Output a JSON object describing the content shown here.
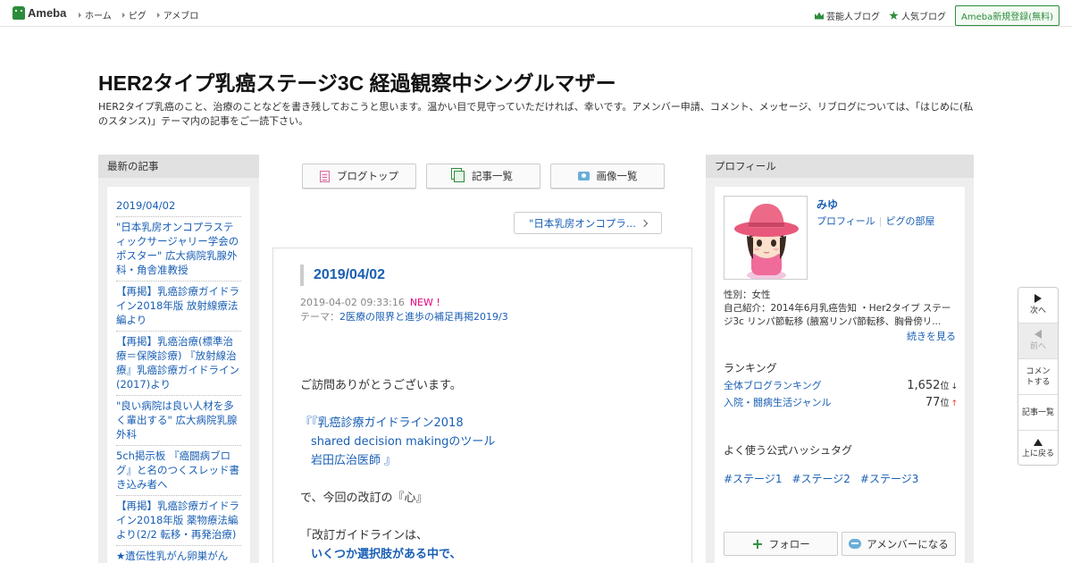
{
  "header": {
    "logo": "Ameba",
    "nav": [
      "ホーム",
      "ピグ",
      "アメブロ"
    ],
    "celebrity_blog": "芸能人ブログ",
    "popular_blog": "人気ブログ",
    "signup": "Ameba新規登録(無料)"
  },
  "blog": {
    "title": "HER2タイプ乳癌ステージ3C 経過観察中シングルマザー",
    "description": "HER2タイプ乳癌のこと、治療のことなどを書き残しておこうと思います。温かい目で見守っていただければ、幸いです。アメンバー申請、コメント、メッセージ、リブログについては、「はじめに(私のスタンス)」テーマ内の記事をご一読下さい。"
  },
  "left": {
    "heading": "最新の記事",
    "items": [
      "2019/04/02",
      "\"日本乳房オンコプラスティックサージャリー学会のポスター\" 広大病院乳腺外科・角舎准教授",
      "【再掲】乳癌診療ガイドライン2018年版 放射線療法編より",
      "【再掲】乳癌治療(標準治療＝保険診療) 『放射線治療』乳癌診療ガイドライン(2017)より",
      "\"良い病院は良い人材を多く輩出する\" 広大病院乳腺外科",
      "5ch掲示板 『癌闘病ブログ』と名のつくスレッド書き込み者へ",
      "【再掲】乳癌診療ガイドライン2018年版 薬物療法編より(2/2 転移・再発治療)",
      "★遺伝性乳がん卵巣がん"
    ]
  },
  "tabs": {
    "blog_top": "ブログトップ",
    "article_list": "記事一覧",
    "image_list": "画像一覧"
  },
  "next_article": "\"日本乳房オンコプラ...",
  "article": {
    "title": "2019/04/02",
    "datetime": "2019-04-02 09:33:16",
    "new_badge": "NEW !",
    "theme_prefix": "テーマ：",
    "theme": "2医療の限界と進歩の補足再掲2019/3",
    "lines": {
      "l1": "ご訪問ありがとうございます。",
      "l2": "『乳癌診療ガイドライン2018",
      "l3": "shared decision makingのツール",
      "l4": "岩田広治医師 』",
      "l5": "で、今回の改訂の『心』",
      "l6": "「改訂ガイドラインは、",
      "l7": "いくつか選択肢がある中で、"
    }
  },
  "profile": {
    "heading": "プロフィール",
    "name": "みゆ",
    "link_profile": "プロフィール",
    "link_pigg": "ピグの部屋",
    "gender": "性別：女性",
    "intro": "自己紹介：2014年6月乳癌告知 ・Her2タイプ ステージ3c リンパ節転移 (腋窩リンパ節転移、胸骨傍リ...",
    "more": "続きを見る",
    "ranking_heading": "ランキング",
    "ranking": [
      {
        "label": "全体ブログランキング",
        "value": "1,652",
        "unit": "位",
        "trend": "↓"
      },
      {
        "label": "入院・闘病生活ジャンル",
        "value": "77",
        "unit": "位",
        "trend": "↑"
      }
    ],
    "hashtag_heading": "よく使う公式ハッシュタグ",
    "hashtags": [
      "#ステージ1",
      "#ステージ2",
      "#ステージ3"
    ],
    "follow": "フォロー",
    "amember": "アメンバーになる"
  },
  "sidenav": {
    "next": "次へ",
    "prev": "前へ",
    "comment": "コメントする",
    "list": "記事一覧",
    "top": "上に戻る"
  },
  "colors": {
    "brand_green": "#2d8c3c",
    "link_blue": "#1a5fb4",
    "new_pink": "#e4007f"
  }
}
